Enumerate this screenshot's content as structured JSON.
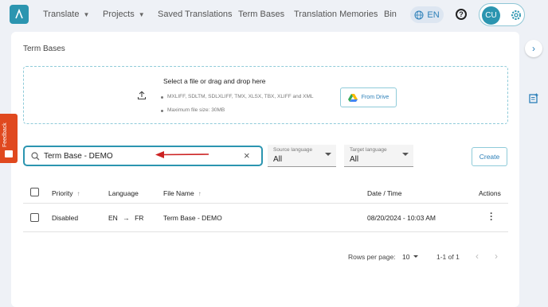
{
  "nav": {
    "items": [
      {
        "label": "Translate",
        "has_dropdown": true
      },
      {
        "label": "Projects",
        "has_dropdown": true
      },
      {
        "label": "Saved Translations",
        "has_dropdown": false
      },
      {
        "label": "Term Bases",
        "has_dropdown": false
      },
      {
        "label": "Translation Memories",
        "has_dropdown": false
      },
      {
        "label": "Bin",
        "has_dropdown": false
      }
    ],
    "language": "EN",
    "help": "?",
    "user_initials": "CU"
  },
  "page": {
    "title": "Term Bases"
  },
  "upload": {
    "title": "Select a file or drag and drop here",
    "formats": "MXLIFF, SDLTM, SDLXLIFF, TMX, XLSX, TBX, XLIFF and XML",
    "max_size": "Maximum file size: 30MB",
    "drive_button": "From Drive"
  },
  "search": {
    "value": "Term Base - DEMO"
  },
  "filters": {
    "source": {
      "label": "Source language",
      "value": "All"
    },
    "target": {
      "label": "Target language",
      "value": "All"
    }
  },
  "create_button": "Create",
  "table": {
    "columns": [
      "Priority",
      "Language",
      "File Name",
      "Date / Time",
      "Actions"
    ],
    "rows": [
      {
        "priority": "Disabled",
        "source": "EN",
        "target": "FR",
        "file_name": "Term Base - DEMO",
        "date_time": "08/20/2024 - 10:03 AM"
      }
    ]
  },
  "pagination": {
    "rows_per_page_label": "Rows per page:",
    "rows_per_page": "10",
    "range": "1-1 of 1"
  },
  "feedback_label": "Feedback",
  "colors": {
    "accent": "#2b95b0",
    "link": "#2b7fb8",
    "feedback": "#e0491f",
    "annotation_arrow": "#cc2222"
  }
}
